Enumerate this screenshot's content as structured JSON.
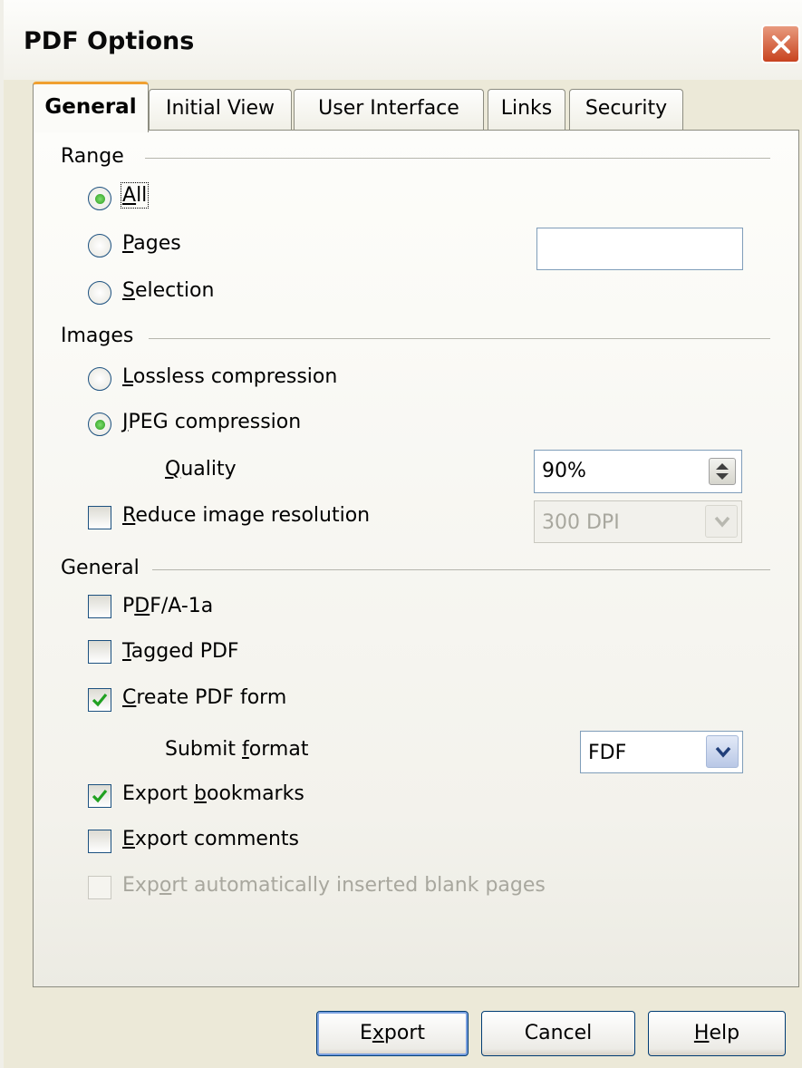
{
  "window": {
    "title": "PDF Options",
    "close_icon": "close-x-icon"
  },
  "tabs": [
    {
      "label": "General",
      "active": true
    },
    {
      "label": "Initial View",
      "active": false
    },
    {
      "label": "User Interface",
      "active": false
    },
    {
      "label": "Links",
      "active": false
    },
    {
      "label": "Security",
      "active": false
    }
  ],
  "range": {
    "label": "Range",
    "all": {
      "label": "All",
      "accel": "A",
      "rest": "ll",
      "checked": true
    },
    "pages": {
      "label": "Pages",
      "accel": "P",
      "rest": "ages",
      "checked": false,
      "value": ""
    },
    "selection": {
      "label": "Selection",
      "accel": "S",
      "rest": "election",
      "checked": false
    }
  },
  "images": {
    "label": "Images",
    "lossless": {
      "label": "Lossless compression",
      "accel": "L",
      "rest": "ossless compression",
      "checked": false
    },
    "jpeg": {
      "label": "JPEG compression",
      "accel": "J",
      "rest": "PEG compression",
      "checked": true
    },
    "quality": {
      "label": "Quality",
      "accel": "Q",
      "rest": "uality",
      "value": "90%"
    },
    "reduce": {
      "label": "Reduce image resolution",
      "accel": "R",
      "rest": "educe image resolution",
      "checked": false
    },
    "resolution": {
      "value": "300 DPI",
      "enabled": false
    }
  },
  "general": {
    "label": "General",
    "pdfa": {
      "label": "PDF/A-1a",
      "pre": "P",
      "accel": "D",
      "rest": "F/A-1a",
      "checked": false
    },
    "tagged": {
      "label": "Tagged PDF",
      "accel": "T",
      "rest": "agged PDF",
      "checked": false
    },
    "create_form": {
      "label": "Create PDF form",
      "accel": "C",
      "rest": "reate PDF form",
      "checked": true
    },
    "submit_format": {
      "label": "Submit format",
      "pre": "Submit ",
      "accel": "f",
      "rest": "ormat",
      "value": "FDF"
    },
    "bookmarks": {
      "label": "Export bookmarks",
      "pre": "Export ",
      "accel": "b",
      "rest": "ookmarks",
      "checked": true
    },
    "comments": {
      "label": "Export comments",
      "accel": "E",
      "rest": "xport comments",
      "checked": false
    },
    "blank_pages": {
      "label": "Export automatically inserted blank pages",
      "pre": "Exp",
      "accel": "o",
      "rest": "rt automatically inserted blank pages",
      "checked": false,
      "enabled": false
    }
  },
  "buttons": {
    "export": {
      "pre": "E",
      "accel": "x",
      "rest": "port"
    },
    "cancel": {
      "label": "Cancel"
    },
    "help": {
      "accel": "H",
      "rest": "elp"
    }
  }
}
